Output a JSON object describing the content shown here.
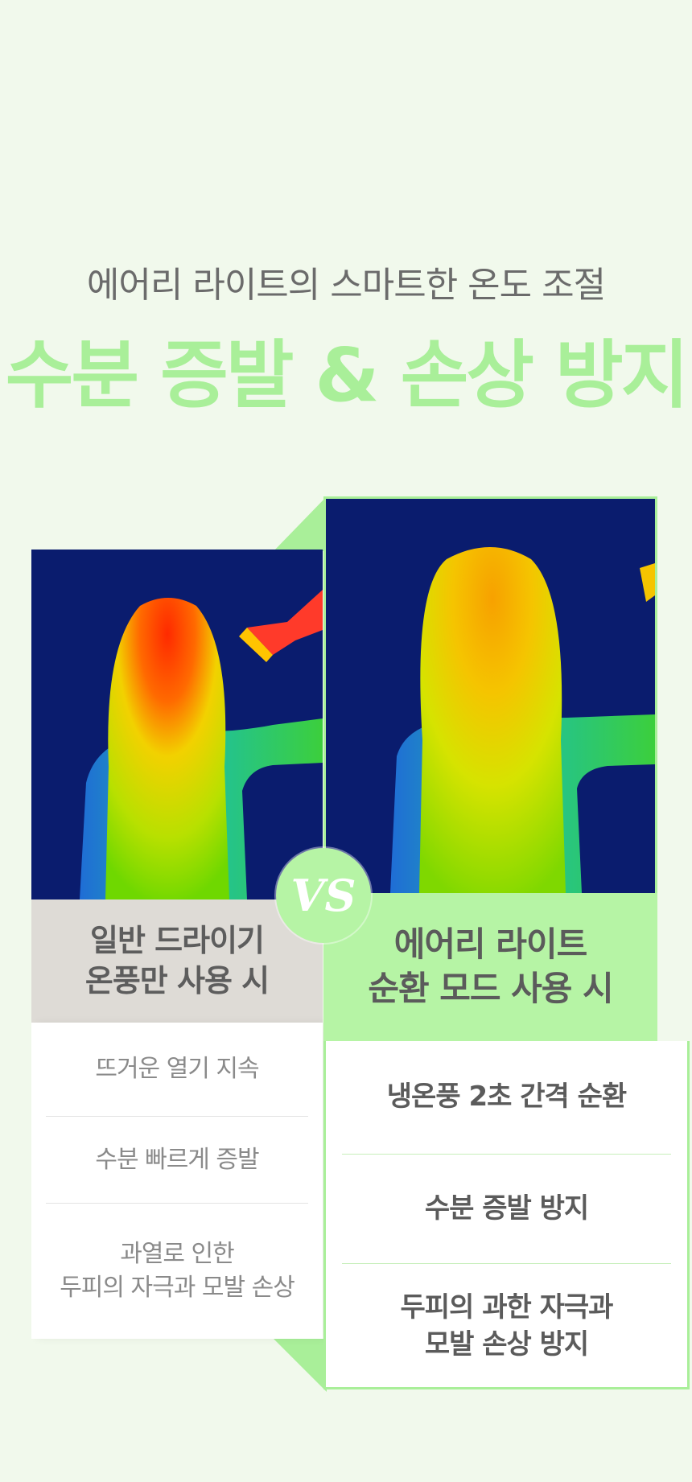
{
  "heading": {
    "subtitle": "에어리 라이트의 스마트한 온도 조절",
    "title": "수분 증발 & 손상 방지"
  },
  "badge": {
    "label": "VS"
  },
  "colors": {
    "background": "#f1f9ec",
    "accent_green": "#a9ef99",
    "header_green": "#b6f4a5",
    "header_gray": "#dedbd6",
    "thermal_bg": "#0a1c6e"
  },
  "left": {
    "image": {
      "icon": "thermal-hair-dryer-hot"
    },
    "header": {
      "line1": "일반 드라이기",
      "line2": "온풍만 사용 시"
    },
    "items": [
      {
        "line1": "뜨거운 열기 지속"
      },
      {
        "line1": "수분 빠르게 증발"
      },
      {
        "line1": "과열로 인한",
        "line2": "두피의 자극과 모발 손상"
      }
    ]
  },
  "right": {
    "image": {
      "icon": "thermal-hair-dryer-cool"
    },
    "header": {
      "line1": "에어리 라이트",
      "line2": "순환 모드 사용 시"
    },
    "items": [
      {
        "line1": "냉온풍 2초 간격 순환"
      },
      {
        "line1": "수분 증발 방지"
      },
      {
        "line1": "두피의 과한 자극과",
        "line2": "모발 손상 방지"
      }
    ]
  }
}
